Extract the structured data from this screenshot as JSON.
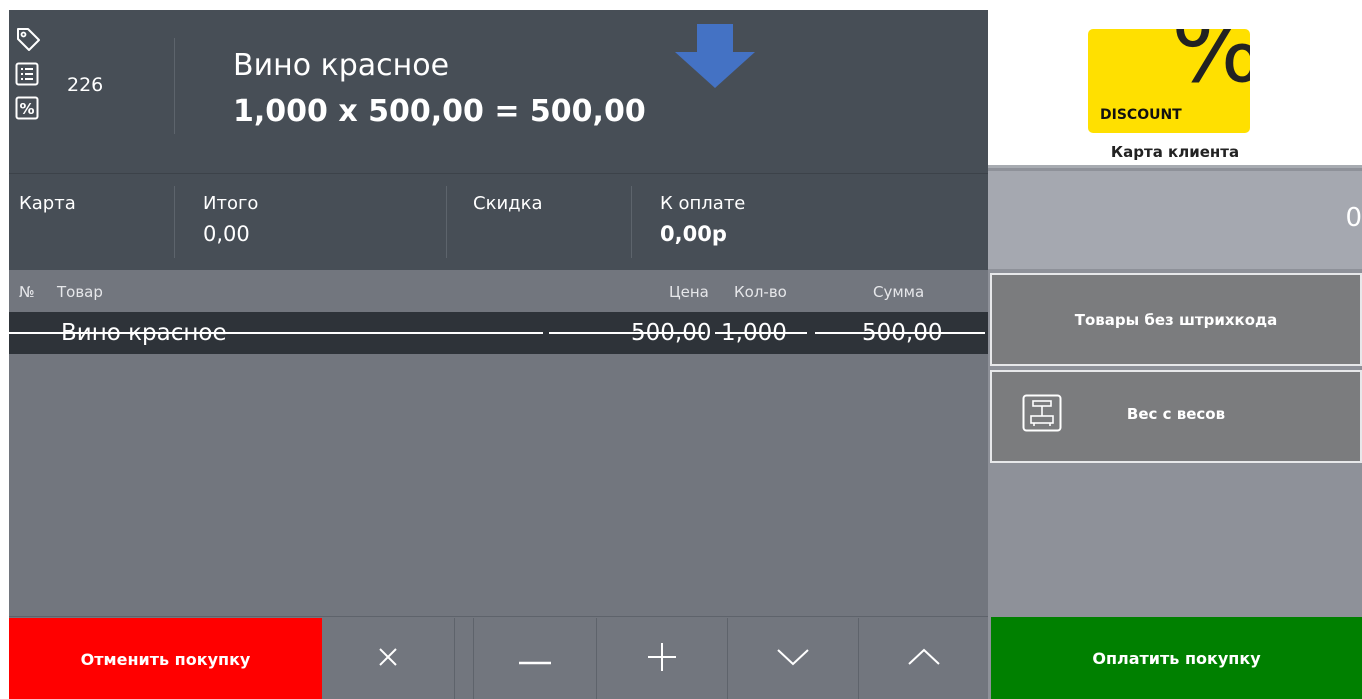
{
  "header": {
    "counter": "226",
    "product_name": "Вино красное",
    "product_calc": "1,000 x 500,00 = 500,00"
  },
  "totals": {
    "card_label": "Карта",
    "total_label": "Итого",
    "total_value": "0,00",
    "discount_label": "Скидка",
    "topay_label": "К оплате",
    "topay_value": "0,00р"
  },
  "table": {
    "columns": [
      "№",
      "Товар",
      "Цена",
      "Кол-во",
      "Сумма"
    ],
    "rows": [
      {
        "name": "Вино красное",
        "price": "500,00",
        "qty": "1,000",
        "sum": "500,00",
        "cancelled": true
      }
    ]
  },
  "bottom": {
    "cancel_label": "Отменить покупку"
  },
  "right": {
    "card_word": "DISCOUNT",
    "card_caption": "Карта клиента",
    "amount": "0",
    "no_barcode_label": "Товары без штрихкода",
    "scale_label": "Вес с весов",
    "pay_label": "Оплатить покупку"
  },
  "colors": {
    "cancel": "#ff0000",
    "pay": "#008000",
    "arrow": "#4472c4",
    "card": "#ffe000"
  }
}
